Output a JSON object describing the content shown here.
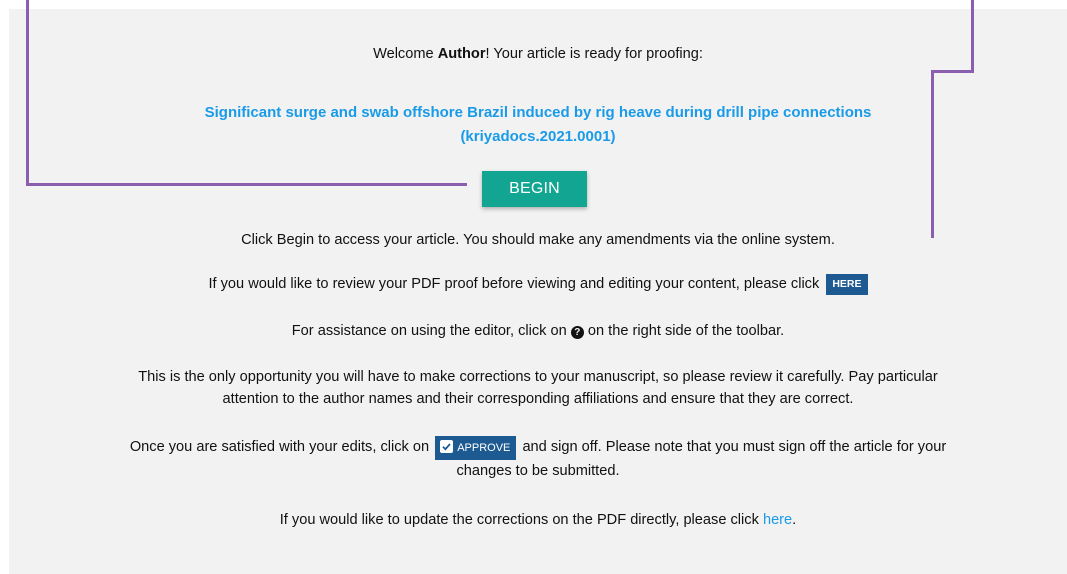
{
  "welcome": {
    "prefix": "Welcome ",
    "name": "Author",
    "suffix": "! Your article is ready for proofing:"
  },
  "article": {
    "title": "Significant surge and swab offshore Brazil induced by rig heave during drill pipe connections",
    "doi": "(kriyadocs.2021.0001)"
  },
  "begin_button": "BEGIN",
  "instructions": {
    "begin_text": "Click Begin to access your article. You should make any amendments via the online system.",
    "pdf_review_text": "If you would like to review your PDF proof before viewing and editing your content, please click",
    "pdf_review_button": "HERE",
    "assist_prefix": "For assistance on using the editor, click on",
    "assist_icon": "question-circle-icon",
    "assist_suffix": "on the right side of the toolbar.",
    "opportunity_line1": "This is the only opportunity you will have to make corrections to your manuscript, so please review it carefully. Pay particular",
    "opportunity_line2": "attention to the author names and their corresponding affiliations and ensure that they are correct.",
    "approve_prefix": "Once you are satisfied with your edits, click on",
    "approve_button": "APPROVE",
    "approve_suffix": "and sign off. Please note that you must sign off the article for your",
    "approve_line2": "changes to be submitted.",
    "update_prefix": "If you would like to update the corrections on the PDF directly, please click",
    "update_link": "here",
    "update_suffix": "."
  },
  "colors": {
    "panel_bg": "#f2f2f2",
    "accent_line": "#8a5fb0",
    "begin_bg": "#12a592",
    "link": "#1a9be8",
    "dark_button": "#1e5a92"
  }
}
